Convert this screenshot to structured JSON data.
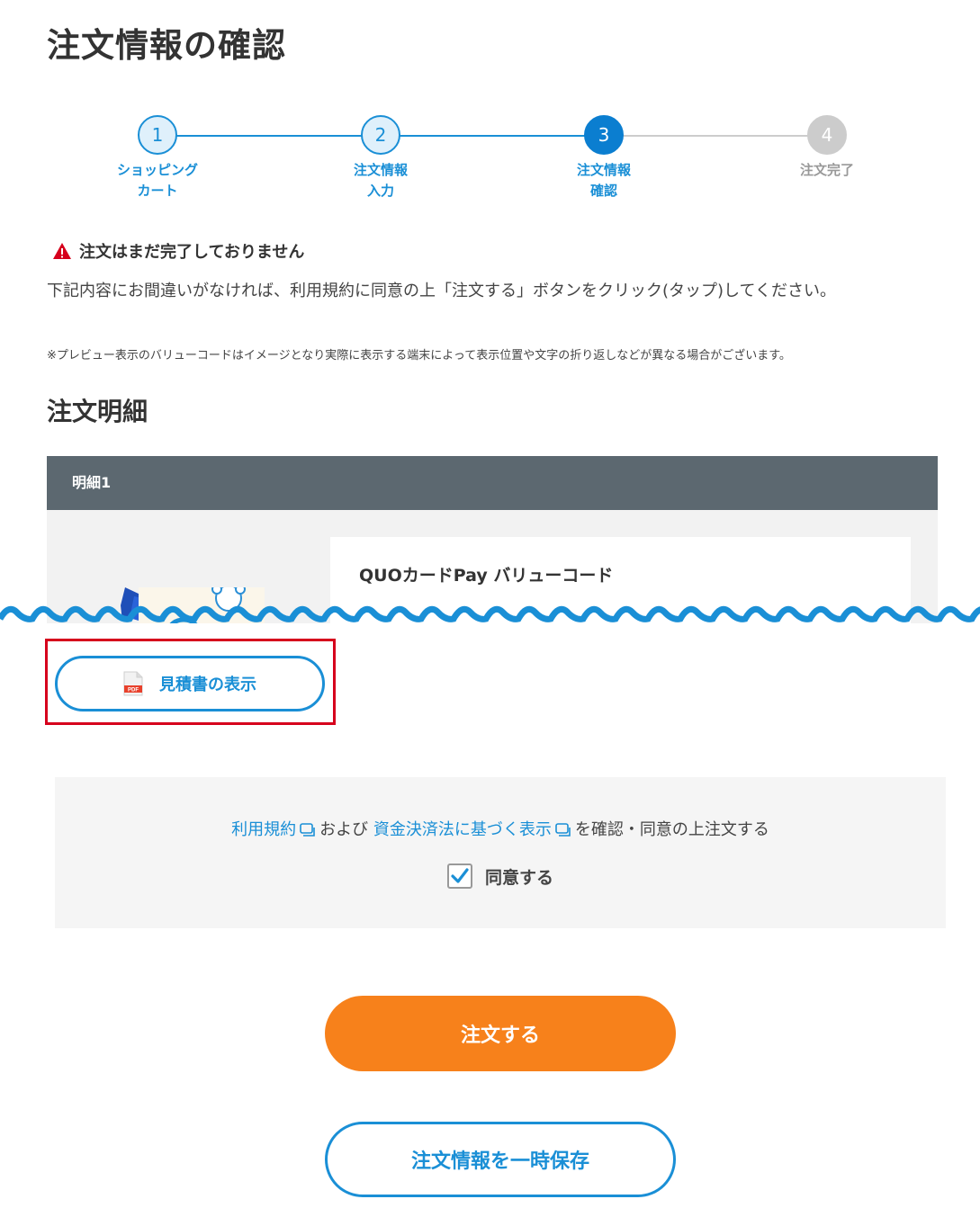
{
  "page": {
    "title": "注文情報の確認"
  },
  "stepper": {
    "steps": [
      {
        "number": "1",
        "label_line1": "ショッピング",
        "label_line2": "カート",
        "state": "done"
      },
      {
        "number": "2",
        "label_line1": "注文情報",
        "label_line2": "入力",
        "state": "done"
      },
      {
        "number": "3",
        "label_line1": "注文情報",
        "label_line2": "確認",
        "state": "current"
      },
      {
        "number": "4",
        "label_line1": "注文完了",
        "label_line2": "",
        "state": "future"
      }
    ]
  },
  "notice": {
    "warning": "注文はまだ完了しておりません",
    "instruction": "下記内容にお間違いがなければ、利用規約に同意の上「注文する」ボタンをクリック(タップ)してください。",
    "preview_note": "※プレビュー表示のバリューコードはイメージとなり実際に表示する端末によって表示位置や文字の折り返しなどが異なる場合がございます。"
  },
  "details": {
    "section_title": "注文明細",
    "item_header": "明細1",
    "product_name": "QUOカードPay バリューコード"
  },
  "estimate": {
    "button_label": "見積書の表示",
    "pdf_badge": "PDF"
  },
  "agreement": {
    "terms_link": "利用規約",
    "conjunction": "および",
    "funds_link": "資金決済法に基づく表示",
    "suffix": "を確認・同意の上注文する",
    "checkbox_label": "同意する",
    "checked": true
  },
  "actions": {
    "order_label": "注文する",
    "save_label": "注文情報を一時保存"
  },
  "colors": {
    "primary_blue": "#1a8fd6",
    "current_step": "#0b7ed0",
    "order_orange": "#f7811b",
    "warning_red": "#d6001c",
    "header_gray": "#5c6870"
  }
}
